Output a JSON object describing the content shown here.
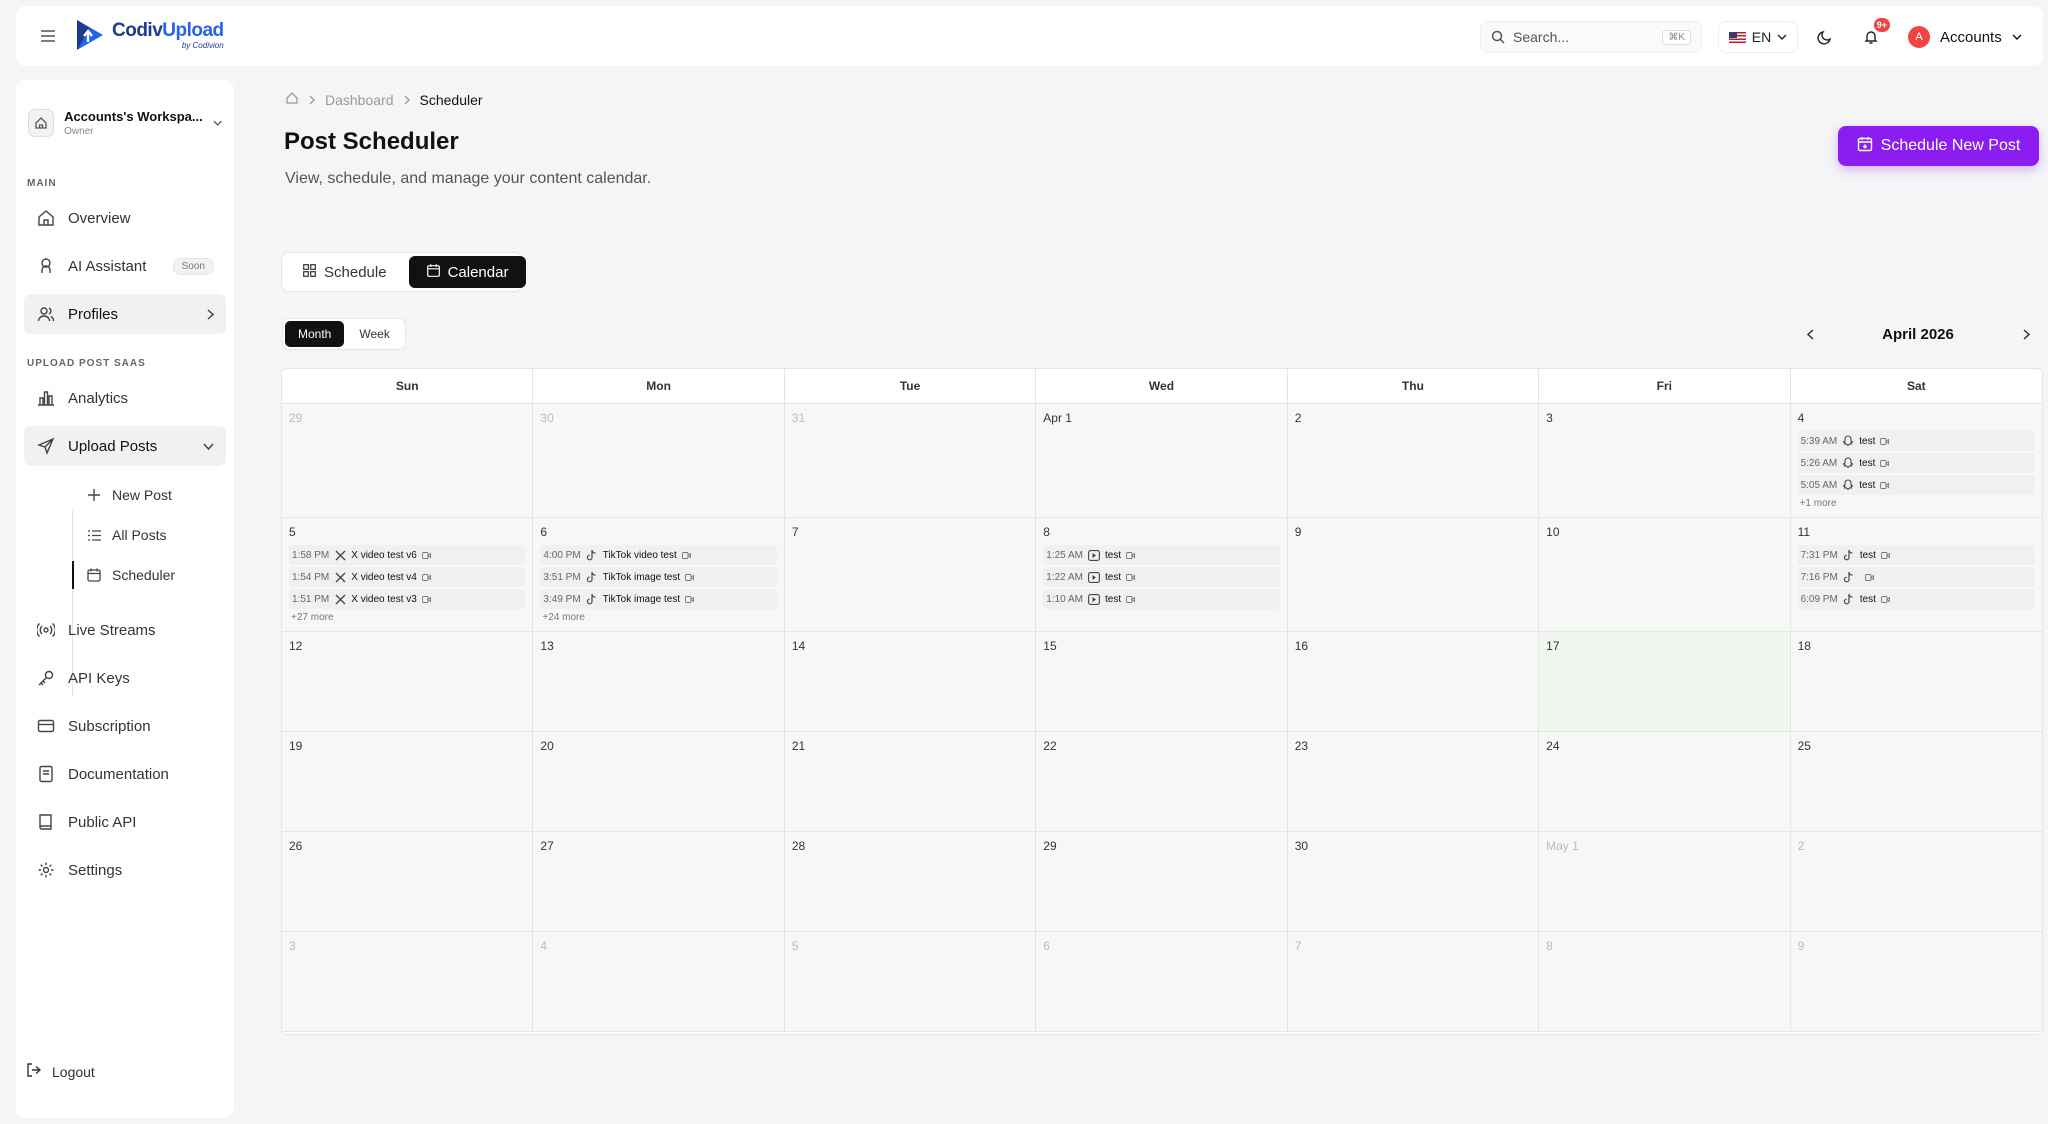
{
  "brand": {
    "name_a": "Codiv",
    "name_b": "Upload",
    "sub": "by Codivion"
  },
  "topbar": {
    "search_placeholder": "Search...",
    "search_kbd": "⌘K",
    "lang": "EN",
    "notif_count": "9+",
    "account_initial": "A",
    "account_label": "Accounts"
  },
  "sidebar": {
    "workspace": {
      "name": "Accounts's Workspa...",
      "role": "Owner"
    },
    "section_main": "MAIN",
    "section_saas": "UPLOAD POST SAAS",
    "items": {
      "overview": "Overview",
      "ai": "AI Assistant",
      "ai_badge": "Soon",
      "profiles": "Profiles",
      "analytics": "Analytics",
      "upload_posts": "Upload Posts",
      "new_post": "New Post",
      "all_posts": "All Posts",
      "scheduler": "Scheduler",
      "live_streams": "Live Streams",
      "api_keys": "API Keys",
      "subscription": "Subscription",
      "documentation": "Documentation",
      "public_api": "Public API",
      "settings": "Settings",
      "logout": "Logout"
    }
  },
  "breadcrumb": {
    "dashboard": "Dashboard",
    "current": "Scheduler"
  },
  "header": {
    "title": "Post Scheduler",
    "subtitle": "View, schedule, and manage your content calendar.",
    "cta": "Schedule New Post"
  },
  "view_tabs": {
    "schedule": "Schedule",
    "calendar": "Calendar"
  },
  "range_tabs": {
    "month": "Month",
    "week": "Week"
  },
  "calendar": {
    "month_label": "April 2026",
    "weekdays": [
      "Sun",
      "Mon",
      "Tue",
      "Wed",
      "Thu",
      "Fri",
      "Sat"
    ],
    "cells": [
      {
        "day": "29",
        "muted": true,
        "events": []
      },
      {
        "day": "30",
        "muted": true,
        "events": []
      },
      {
        "day": "31",
        "muted": true,
        "events": []
      },
      {
        "day": "Apr 1",
        "events": []
      },
      {
        "day": "2",
        "events": []
      },
      {
        "day": "3",
        "events": []
      },
      {
        "day": "4",
        "events": [
          {
            "time": "5:39 AM",
            "icon": "snapchat-icon",
            "title": "test"
          },
          {
            "time": "5:26 AM",
            "icon": "snapchat-icon",
            "title": "test"
          },
          {
            "time": "5:05 AM",
            "icon": "snapchat-icon",
            "title": "test"
          }
        ],
        "more": "+1 more"
      },
      {
        "day": "5",
        "events": [
          {
            "time": "1:58 PM",
            "icon": "x-icon",
            "title": "X video test v6"
          },
          {
            "time": "1:54 PM",
            "icon": "x-icon",
            "title": "X video test v4"
          },
          {
            "time": "1:51 PM",
            "icon": "x-icon",
            "title": "X video test v3"
          }
        ],
        "more": "+27 more"
      },
      {
        "day": "6",
        "events": [
          {
            "time": "4:00 PM",
            "icon": "tiktok-icon",
            "title": "TikTok video test"
          },
          {
            "time": "3:51 PM",
            "icon": "tiktok-icon",
            "title": "TikTok image test"
          },
          {
            "time": "3:49 PM",
            "icon": "tiktok-icon",
            "title": "TikTok image test"
          }
        ],
        "more": "+24 more"
      },
      {
        "day": "7",
        "events": []
      },
      {
        "day": "8",
        "events": [
          {
            "time": "1:25 AM",
            "icon": "youtube-icon",
            "title": "test"
          },
          {
            "time": "1:22 AM",
            "icon": "youtube-icon",
            "title": "test"
          },
          {
            "time": "1:10 AM",
            "icon": "youtube-icon",
            "title": "test"
          }
        ]
      },
      {
        "day": "9",
        "events": []
      },
      {
        "day": "10",
        "events": []
      },
      {
        "day": "11",
        "events": [
          {
            "time": "7:31 PM",
            "icon": "tiktok-icon",
            "title": "test"
          },
          {
            "time": "7:16 PM",
            "icon": "tiktok-icon",
            "title": ""
          },
          {
            "time": "6:09 PM",
            "icon": "tiktok-icon",
            "title": "test"
          }
        ]
      },
      {
        "day": "12",
        "events": []
      },
      {
        "day": "13",
        "events": []
      },
      {
        "day": "14",
        "events": []
      },
      {
        "day": "15",
        "events": []
      },
      {
        "day": "16",
        "events": []
      },
      {
        "day": "17",
        "today": true,
        "events": []
      },
      {
        "day": "18",
        "events": []
      },
      {
        "day": "19",
        "events": []
      },
      {
        "day": "20",
        "events": []
      },
      {
        "day": "21",
        "events": []
      },
      {
        "day": "22",
        "events": []
      },
      {
        "day": "23",
        "events": []
      },
      {
        "day": "24",
        "events": []
      },
      {
        "day": "25",
        "events": []
      },
      {
        "day": "26",
        "events": []
      },
      {
        "day": "27",
        "events": []
      },
      {
        "day": "28",
        "events": []
      },
      {
        "day": "29",
        "events": []
      },
      {
        "day": "30",
        "events": []
      },
      {
        "day": "May 1",
        "muted": true,
        "events": []
      },
      {
        "day": "2",
        "muted": true,
        "events": []
      },
      {
        "day": "3",
        "muted": true,
        "events": []
      },
      {
        "day": "4",
        "muted": true,
        "events": []
      },
      {
        "day": "5",
        "muted": true,
        "events": []
      },
      {
        "day": "6",
        "muted": true,
        "events": []
      },
      {
        "day": "7",
        "muted": true,
        "events": []
      },
      {
        "day": "8",
        "muted": true,
        "events": []
      },
      {
        "day": "9",
        "muted": true,
        "events": []
      }
    ]
  }
}
